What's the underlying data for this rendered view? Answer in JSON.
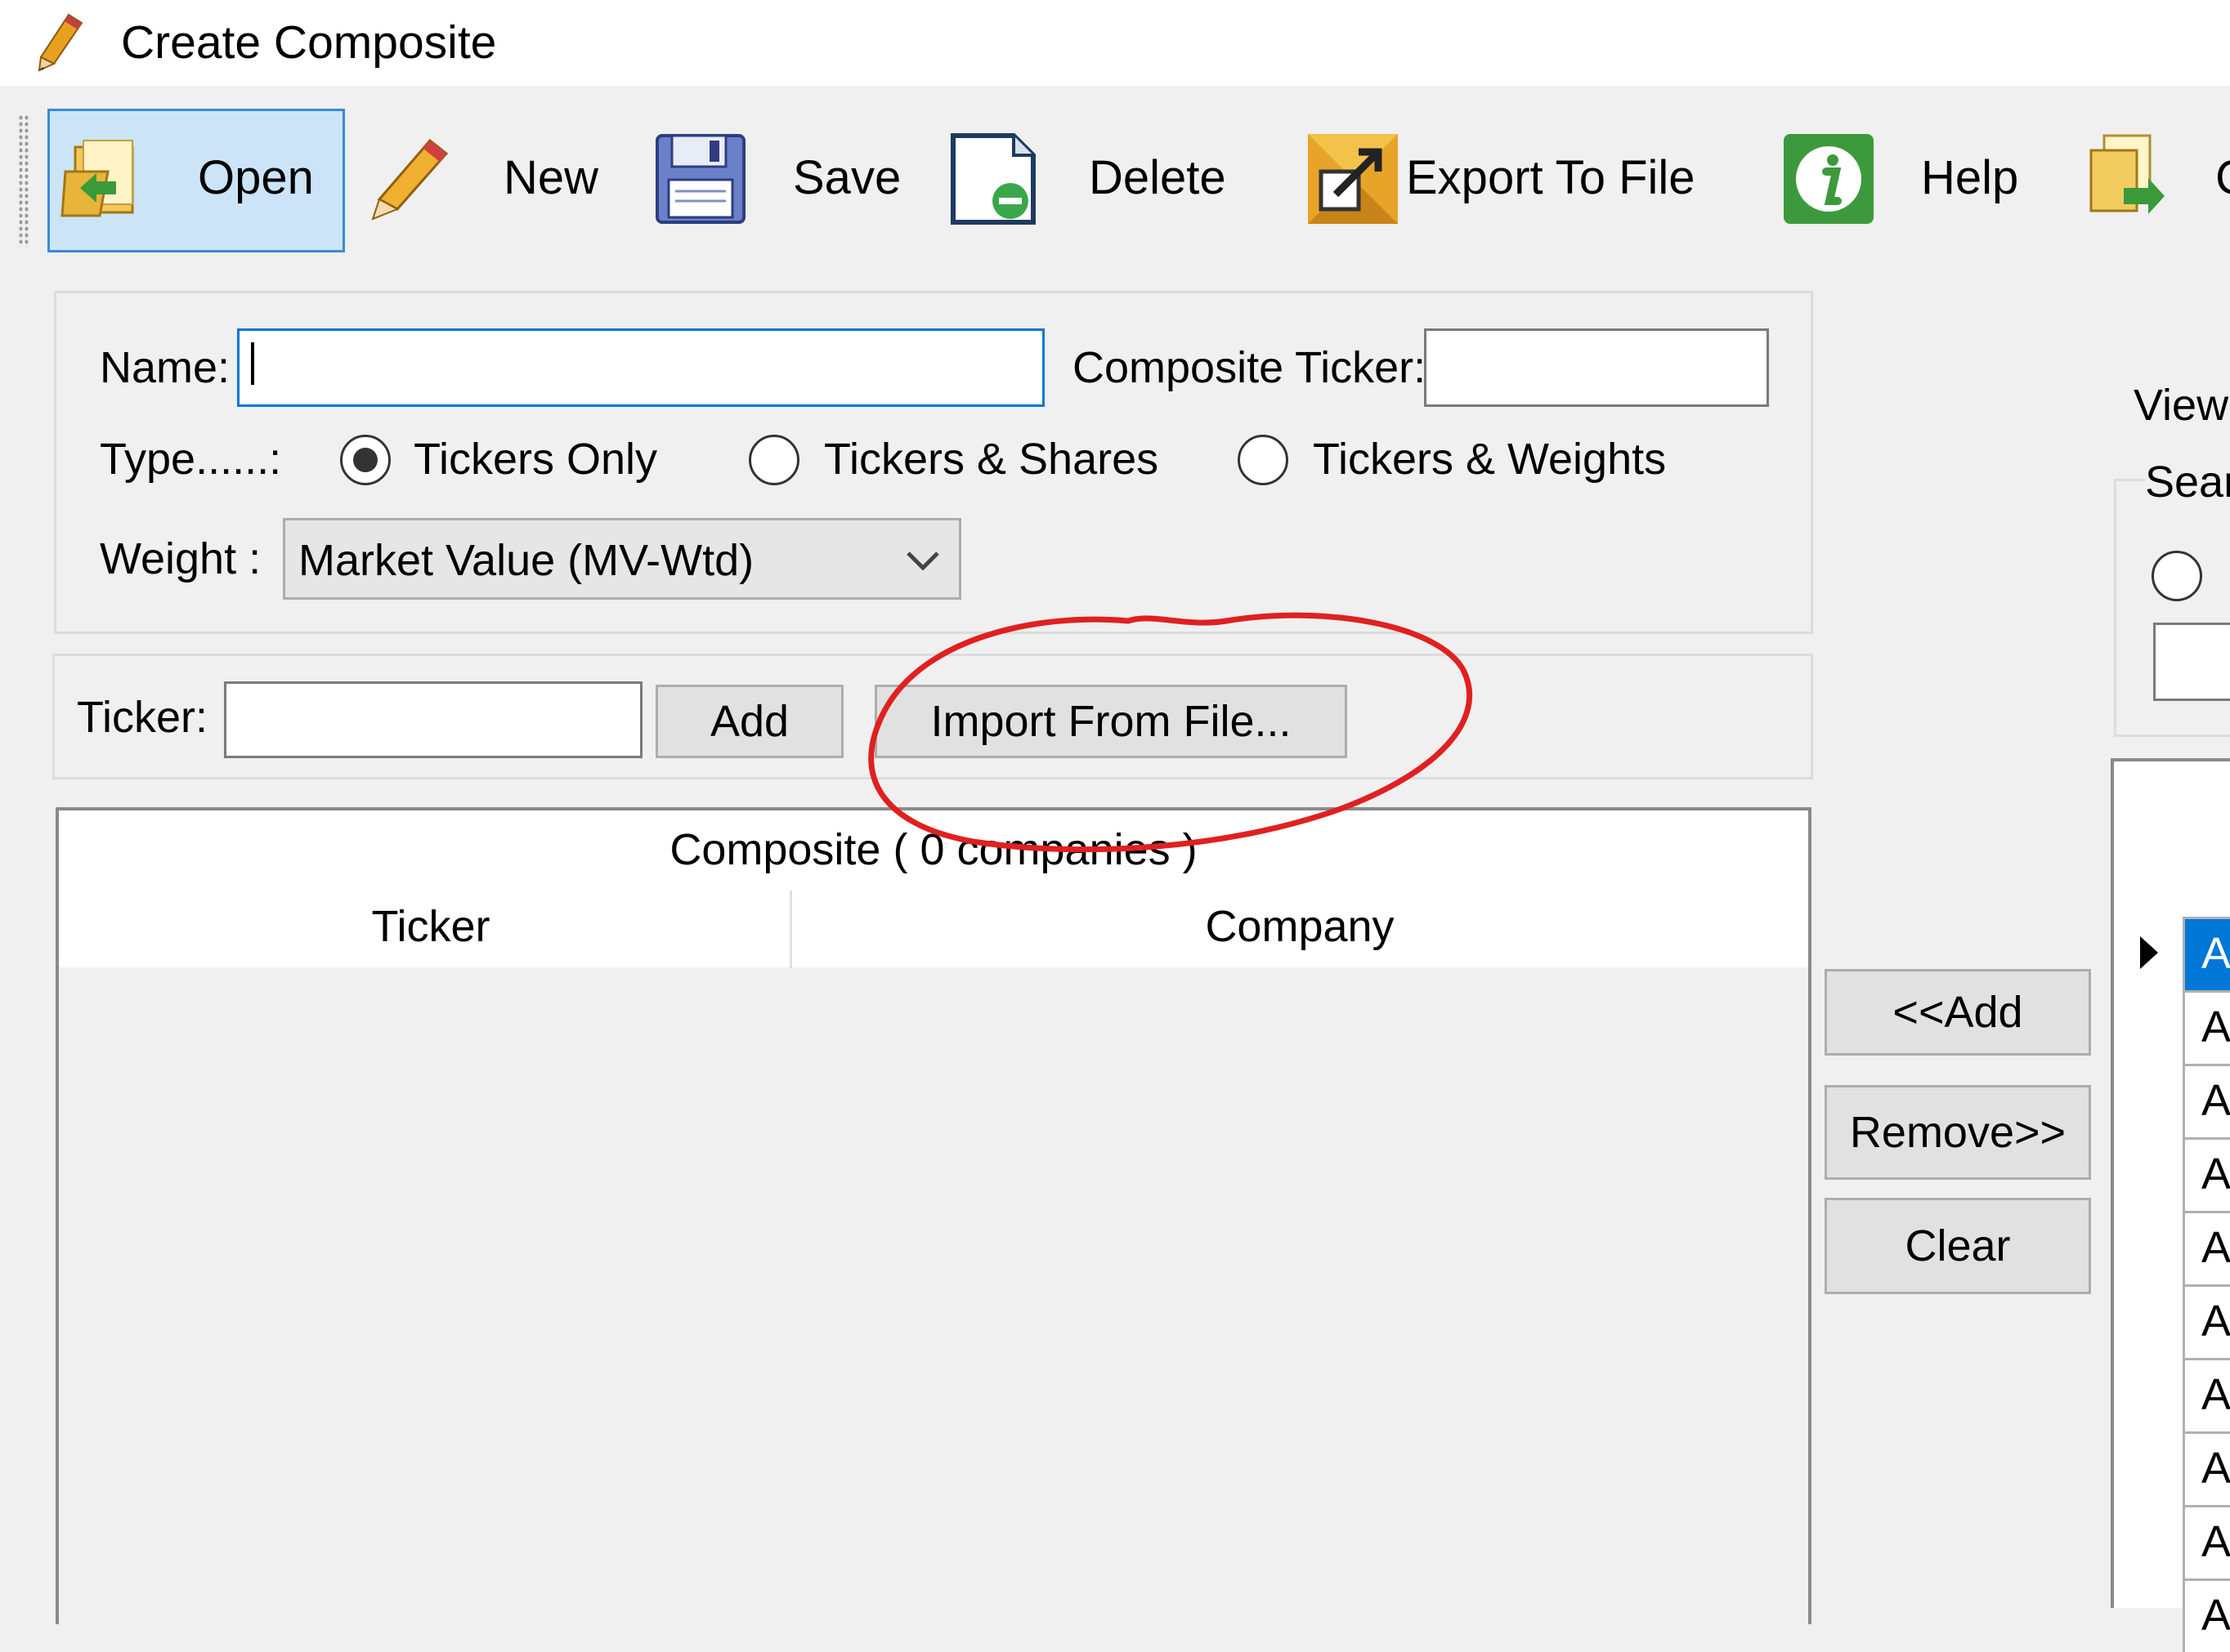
{
  "window": {
    "title": "Create Composite"
  },
  "toolbar": {
    "open": "Open",
    "new": "New",
    "save": "Save",
    "delete": "Delete",
    "export": "Export To File",
    "help": "Help",
    "cut_label": "C"
  },
  "form": {
    "name_label": "Name:",
    "name_value": "",
    "composite_ticker_label": "Composite Ticker:",
    "composite_ticker_value": "",
    "type_label": "Type......:",
    "type_options": [
      "Tickers Only",
      "Tickers & Shares",
      "Tickers & Weights"
    ],
    "type_selected": "Tickers Only",
    "weight_label": "Weight :",
    "weight_value": "Market Value (MV-Wtd)"
  },
  "ticker_bar": {
    "ticker_label": "Ticker:",
    "ticker_value": "",
    "add_button": "Add",
    "import_button": "Import From File..."
  },
  "composite_grid": {
    "title": "Composite ( 0 companies )",
    "columns": [
      "Ticker",
      "Company"
    ]
  },
  "middle_buttons": {
    "add": "<<Add",
    "remove": "Remove>>",
    "clear": "Clear"
  },
  "right_panel": {
    "view_label": "View",
    "search_label": "Sear",
    "rows": [
      "A",
      "A",
      "A",
      "A",
      "A",
      "A",
      "A",
      "A",
      "A",
      "A"
    ]
  },
  "colors": {
    "accent": "#0078d7",
    "annotation": "#e02020",
    "background": "#f0f0f0"
  }
}
